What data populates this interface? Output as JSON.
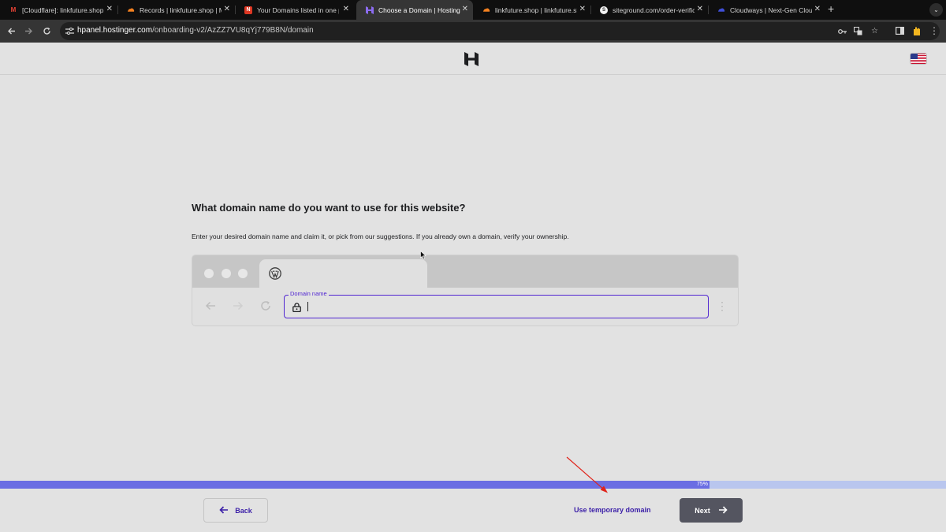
{
  "browser": {
    "tabs": [
      {
        "title": "[Cloudflare]: linkfuture.shop |",
        "icon": "gmail-icon",
        "active": false
      },
      {
        "title": "Records | linkfuture.shop | M",
        "icon": "cloudflare-icon",
        "active": false
      },
      {
        "title": "Your Domains listed in one pl",
        "icon": "namecheap-icon",
        "active": false
      },
      {
        "title": "Choose a Domain | Hostinger",
        "icon": "hostinger-icon",
        "active": true
      },
      {
        "title": "linkfuture.shop | linkfuture.sh",
        "icon": "cloudflare-icon",
        "active": false
      },
      {
        "title": "siteground.com/order-verific",
        "icon": "siteground-icon",
        "active": false
      },
      {
        "title": "Cloudways | Next-Gen Cloud",
        "icon": "cloudways-icon",
        "active": false
      }
    ],
    "url_host": "hpanel.hostinger.com",
    "url_path": "/onboarding-v2/AzZZ7VU8qYj779B8N/domain"
  },
  "page": {
    "question": "What domain name do you want to use for this website?",
    "helper": "Enter your desired domain name and claim it, or pick from our suggestions. If you already own a domain, verify your ownership.",
    "domain_field": {
      "label": "Domain name",
      "value": ""
    }
  },
  "progress": {
    "value": 0.75,
    "label": "75%"
  },
  "footer": {
    "back_label": "Back",
    "temp_domain_label": "Use temporary domain",
    "next_label": "Next"
  },
  "colors": {
    "accent": "#5025d1",
    "progress_fill": "#6b6ee3",
    "progress_track": "#b9c6ee",
    "next_button": "#545560",
    "annotation_arrow": "#e0241b"
  }
}
